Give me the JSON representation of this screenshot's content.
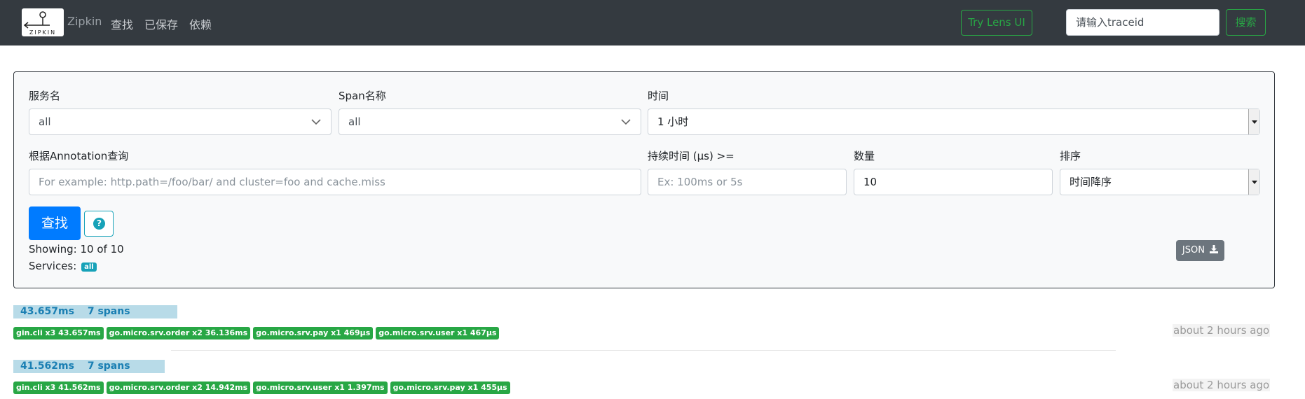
{
  "navbar": {
    "logo_text": "ZIPKIN",
    "brand": "Zipkin",
    "links": [
      "查找",
      "已保存",
      "依赖"
    ],
    "lens_button": "Try Lens UI",
    "traceid_placeholder": "请输入traceid",
    "search_button": "搜索"
  },
  "form": {
    "service_label": "服务名",
    "service_value": "all",
    "span_label": "Span名称",
    "span_value": "all",
    "time_label": "时间",
    "time_value": "1 小时",
    "annotation_label": "根据Annotation查询",
    "annotation_placeholder": "For example: http.path=/foo/bar/ and cluster=foo and cache.miss",
    "duration_label": "持续时间 (μs) >=",
    "duration_placeholder": "Ex: 100ms or 5s",
    "limit_label": "数量",
    "limit_value": "10",
    "sort_label": "排序",
    "sort_value": "时间降序",
    "find_button": "查找",
    "help_icon": "question-circle-icon",
    "showing": "Showing: 10 of 10",
    "services_label": "Services:",
    "services_badge": "all",
    "json_button": "JSON",
    "json_icon": "download-icon"
  },
  "colors": {
    "navbar_bg": "#343a40",
    "primary": "#007bff",
    "success": "#28a745",
    "info": "#17a2b8",
    "secondary": "#6c757d"
  },
  "traces": [
    {
      "duration": "43.657ms",
      "spans": "7 spans",
      "time": "about 2 hours ago",
      "services": [
        "gin.cli x3 43.657ms",
        "go.micro.srv.order x2 36.136ms",
        "go.micro.srv.pay x1 469μs",
        "go.micro.srv.user x1 467μs"
      ]
    },
    {
      "duration": "41.562ms",
      "spans": "7 spans",
      "time": "about 2 hours ago",
      "services": [
        "gin.cli x3 41.562ms",
        "go.micro.srv.order x2 14.942ms",
        "go.micro.srv.user x1 1.397ms",
        "go.micro.srv.pay x1 455μs"
      ]
    }
  ]
}
